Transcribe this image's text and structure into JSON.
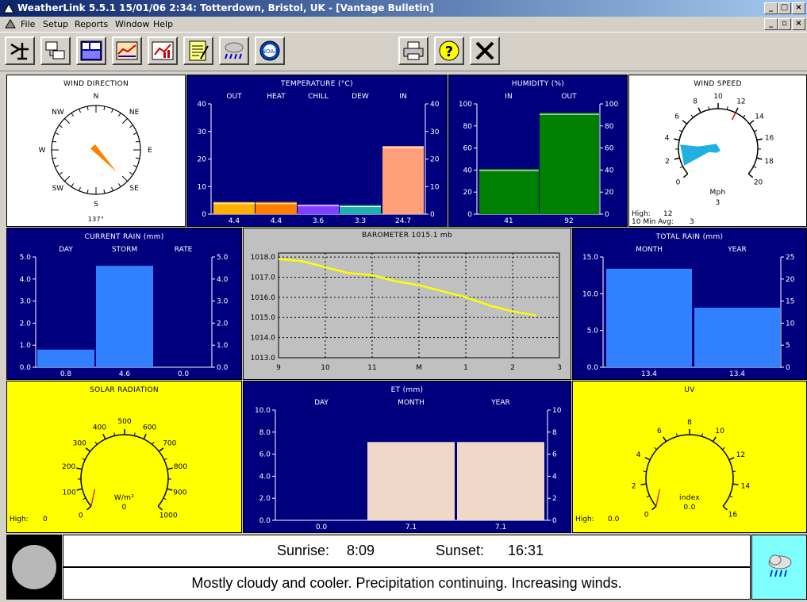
{
  "window": {
    "title": "WeatherLink 5.5.1  15/01/06   2:34: Totterdown, Bristol, UK - [Vantage Bulletin]"
  },
  "menu": [
    "File",
    "Setup",
    "Reports",
    "Window",
    "Help"
  ],
  "toolbar": [
    "station-icon",
    "download-icon",
    "bulletin-icon",
    "summary-icon",
    "graph-icon",
    "notes-icon",
    "weather-icon",
    "noaa-icon",
    "print-icon",
    "help-icon",
    "close-icon"
  ],
  "toolbar_noaa_text": "NOAA",
  "wind_direction": {
    "title": "WIND DIRECTION",
    "labels": [
      "N",
      "NE",
      "E",
      "SE",
      "S",
      "SW",
      "W",
      "NW"
    ],
    "degrees": 137,
    "readout": "137°"
  },
  "temperature": {
    "title": "TEMPERATURE (°C)",
    "chart_data": {
      "type": "bar",
      "categories": [
        "OUT",
        "HEAT",
        "CHILL",
        "DEW",
        "IN"
      ],
      "values": [
        4.4,
        4.4,
        3.6,
        3.3,
        24.7
      ],
      "value_labels": [
        "4.4",
        "4.4",
        "3.6",
        "3.3",
        "24.7"
      ],
      "ylim": [
        0,
        40
      ],
      "yticks": [
        "0",
        "10",
        "20",
        "30",
        "40"
      ],
      "colors": [
        "#ffb000",
        "#ff8000",
        "#8040ff",
        "#20b0b0",
        "#ffa07a"
      ]
    }
  },
  "humidity": {
    "title": "HUMIDITY (%)",
    "chart_data": {
      "type": "bar",
      "categories": [
        "IN",
        "OUT"
      ],
      "values": [
        41,
        92
      ],
      "value_labels": [
        "41",
        "92"
      ],
      "ylim": [
        0,
        100
      ],
      "yticks": [
        "0",
        "20",
        "40",
        "60",
        "80",
        "100"
      ],
      "colors": [
        "#008000",
        "#008000"
      ]
    }
  },
  "wind_speed": {
    "title": "WIND SPEED",
    "unit": "Mph",
    "value": "3",
    "ticks": [
      "0",
      "2",
      "4",
      "6",
      "8",
      "10",
      "12",
      "14",
      "16",
      "18",
      "20"
    ],
    "high_label": "High:",
    "high": "12",
    "avg_label": "10 Min Avg:",
    "avg": "3",
    "avg_value": 3
  },
  "current_rain": {
    "title": "CURRENT RAIN (mm)",
    "chart_data": {
      "type": "bar",
      "categories": [
        "DAY",
        "STORM",
        "RATE"
      ],
      "values": [
        0.8,
        4.6,
        0.0
      ],
      "value_labels": [
        "0.8",
        "4.6",
        "0.0"
      ],
      "ylim": [
        0,
        5
      ],
      "yticks": [
        "0.0",
        "1.0",
        "2.0",
        "3.0",
        "4.0",
        "5.0"
      ],
      "colors": [
        "#3080ff",
        "#3080ff",
        "#3080ff"
      ]
    }
  },
  "barometer": {
    "title": "BAROMETER 1015.1 mb",
    "chart_data": {
      "type": "line",
      "x_ticks": [
        "9",
        "10",
        "11",
        "M",
        "1",
        "2",
        "3"
      ],
      "yticks": [
        "1013.0",
        "1014.0",
        "1015.0",
        "1016.0",
        "1017.0",
        "1018.0"
      ],
      "ylim": [
        1013,
        1018.2
      ],
      "x": [
        9.0,
        9.5,
        10.0,
        10.5,
        11.0,
        11.5,
        12.0,
        12.5,
        13.0,
        13.5,
        14.0,
        14.5
      ],
      "values": [
        1017.9,
        1017.8,
        1017.5,
        1017.2,
        1017.1,
        1016.8,
        1016.6,
        1016.3,
        1016.0,
        1015.6,
        1015.3,
        1015.1
      ]
    }
  },
  "total_rain": {
    "title": "TOTAL RAIN (mm)",
    "chart_data": {
      "type": "bar",
      "categories": [
        "MONTH",
        "YEAR"
      ],
      "values": [
        13.4,
        13.4
      ],
      "value_labels": [
        "13.4",
        "13.4"
      ],
      "ylim_left": [
        0,
        15
      ],
      "yticks_left": [
        "0.0",
        "5.0",
        "10.0",
        "15.0"
      ],
      "ylim_right": [
        0,
        25
      ],
      "yticks_right": [
        "0",
        "5",
        "10",
        "15",
        "20",
        "25"
      ],
      "bar_heights_left_scale": [
        13.4,
        8.1
      ],
      "colors": [
        "#3080ff",
        "#3080ff"
      ]
    }
  },
  "solar": {
    "title": "SOLAR RADIATION",
    "unit": "W/m²",
    "value": "0",
    "ticks": [
      "0",
      "100",
      "200",
      "300",
      "400",
      "500",
      "600",
      "700",
      "800",
      "900",
      "1000"
    ],
    "high_label": "High:",
    "high": "0"
  },
  "et": {
    "title": "ET (mm)",
    "chart_data": {
      "type": "bar",
      "categories": [
        "DAY",
        "MONTH",
        "YEAR"
      ],
      "values": [
        0.0,
        7.1,
        7.1
      ],
      "value_labels": [
        "0.0",
        "7.1",
        "7.1"
      ],
      "ylim": [
        0,
        10
      ],
      "yticks_left": [
        "0.0",
        "2.0",
        "4.0",
        "6.0",
        "8.0",
        "10.0"
      ],
      "yticks_right": [
        "0",
        "2",
        "4",
        "6",
        "8",
        "10"
      ],
      "colors": [
        "#f0d8c8",
        "#f0d8c8",
        "#f0d8c8"
      ]
    }
  },
  "uv": {
    "title": "UV",
    "unit": "index",
    "value": "0.0",
    "ticks": [
      "0",
      "2",
      "4",
      "6",
      "8",
      "10",
      "12",
      "14",
      "16"
    ],
    "high_label": "High:",
    "high": "0.0"
  },
  "sun": {
    "sunrise_label": "Sunrise:",
    "sunrise": "8:09",
    "sunset_label": "Sunset:",
    "sunset": "16:31"
  },
  "forecast": {
    "text": "Mostly cloudy and cooler.  Precipitation continuing.  Increasing winds.",
    "icon": "cloud-rain-icon"
  }
}
